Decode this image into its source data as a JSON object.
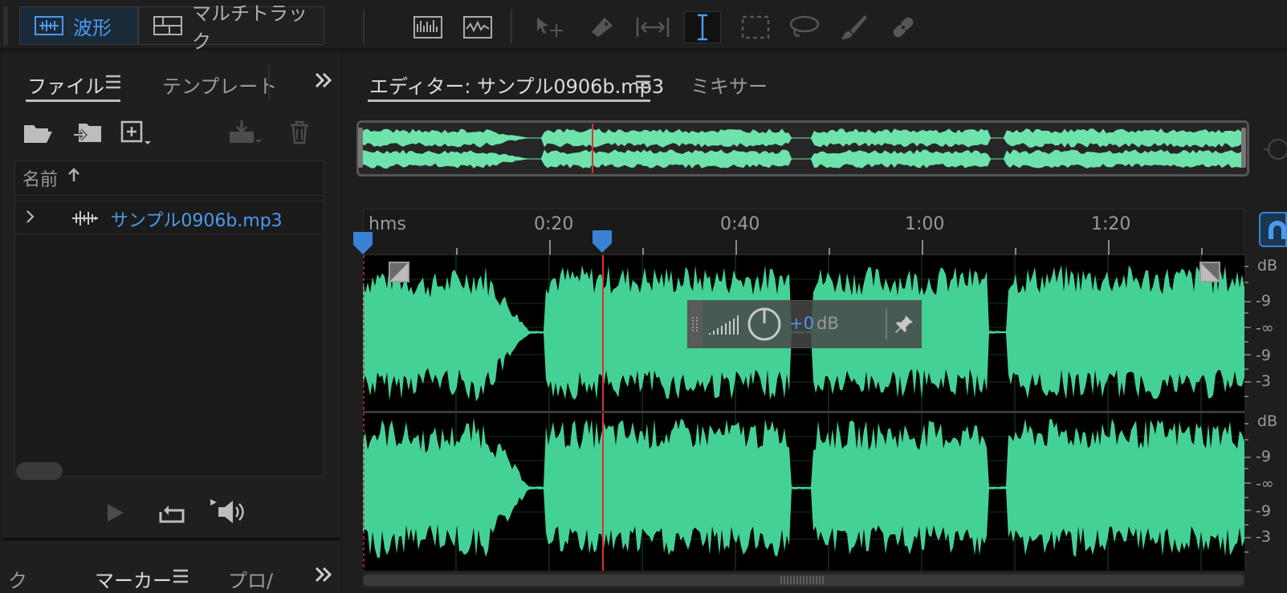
{
  "colors": {
    "waveform": "#44d195",
    "overview_waveform": "#6ee3ab",
    "accent_blue": "#4a9bf0",
    "playhead": "#e03030"
  },
  "toolbar": {
    "waveform_mode_label": "波形",
    "multitrack_mode_label": "マルチトラック",
    "icons": [
      "spectral-frequency-icon",
      "spectral-pitch-icon",
      "move-tool-icon",
      "razor-tool-icon",
      "slip-tool-icon",
      "time-selection-tool-icon",
      "marquee-tool-icon",
      "lasso-tool-icon",
      "brush-tool-icon",
      "spot-healing-icon"
    ]
  },
  "files_panel": {
    "tab_files": "ファイル",
    "tab_templates": "テンプレート",
    "column_name": "名前",
    "items": [
      {
        "name": "サンプル0906b.mp3"
      }
    ]
  },
  "bottom_panel": {
    "tab_partial": "ク",
    "tab_markers": "マーカー",
    "tab_properties_partial": "プロ/"
  },
  "editor": {
    "tab_editor": "エディター: サンプル0906b.mp3",
    "tab_mixer": "ミキサー",
    "ruler": {
      "unit_label": "hms",
      "time_labels": [
        "0:20",
        "0:40",
        "1:00",
        "1:20"
      ]
    },
    "hud": {
      "gain_value": "+0",
      "gain_unit": "dB"
    },
    "channels": [
      {
        "db_labels": [
          "dB",
          "-9",
          "-∞",
          "-9",
          "-3"
        ]
      },
      {
        "db_labels": [
          "dB",
          "-9",
          "-∞",
          "-9",
          "-3"
        ]
      }
    ]
  }
}
